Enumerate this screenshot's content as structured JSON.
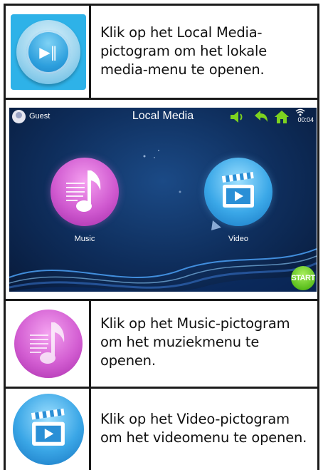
{
  "rows": [
    {
      "icon": "local-media-icon",
      "text": "Klik op het Local Media-\npictogram om het lokale\nmedia-menu te openen."
    },
    {
      "screen": {
        "user": "Guest",
        "title": "Local Media",
        "time": "00:04",
        "icons": [
          "avatar-icon",
          "volume-icon",
          "back-arrow-icon",
          "home-icon",
          "wifi-icon"
        ],
        "apps": [
          {
            "label": "Music",
            "icon": "music-note-icon"
          },
          {
            "label": "Video",
            "icon": "clapperboard-icon"
          }
        ],
        "start_label": "START",
        "colors": {
          "background": "#0e2d5b",
          "music": "#d05ad0",
          "video": "#3ba8e8",
          "start": "#5cbf1e",
          "toolbar": "#7dd21f"
        }
      }
    },
    {
      "icon": "music-icon",
      "text": "Klik op het Music-pictogram\nom het muziekmenu te\nopenen."
    },
    {
      "icon": "video-icon",
      "text": "Klik op het Video-pictogram\nom het videomenu te openen."
    }
  ]
}
